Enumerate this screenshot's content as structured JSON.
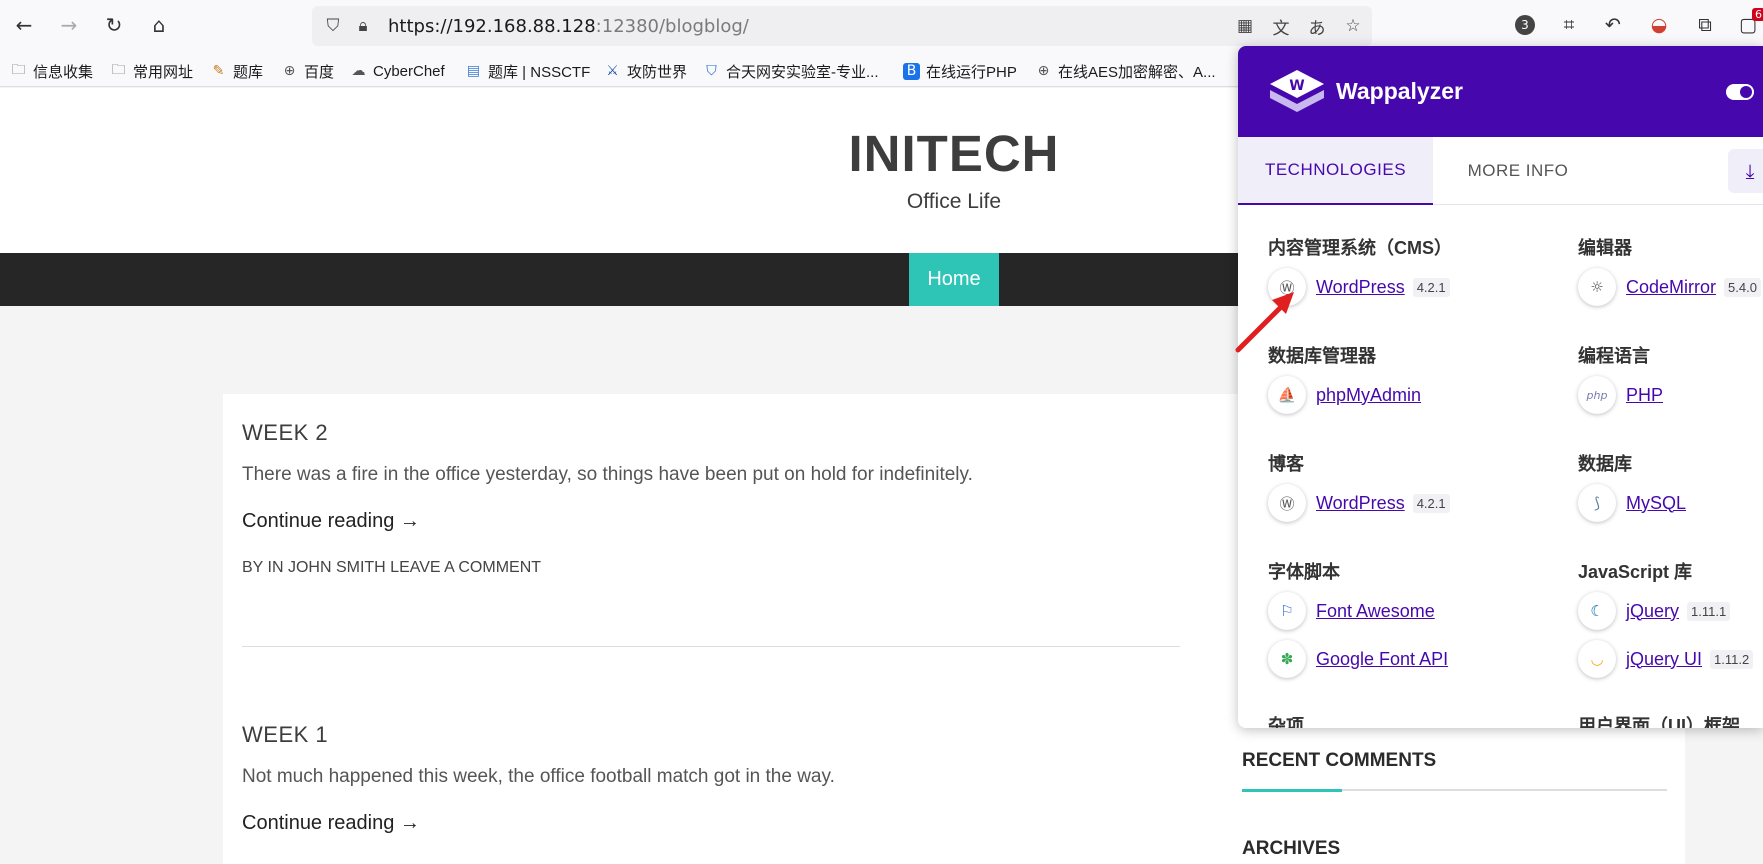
{
  "browser": {
    "url_host": "https://192.168.88.128",
    "url_path": ":12380/blogblog/",
    "badge_count": "3",
    "notif_count": "6"
  },
  "bookmarks": [
    {
      "label": "信息收集",
      "icon": "folder-icon"
    },
    {
      "label": "常用网址",
      "icon": "folder-icon"
    },
    {
      "label": "题库",
      "icon": "site-icon"
    },
    {
      "label": "百度",
      "icon": "globe-icon"
    },
    {
      "label": "CyberChef",
      "icon": "chef-icon"
    },
    {
      "label": "题库 | NSSCTF",
      "icon": "site-icon"
    },
    {
      "label": "攻防世界",
      "icon": "site-icon"
    },
    {
      "label": "合天网安实验室-专业...",
      "icon": "shield-icon"
    },
    {
      "label": "在线运行PHP",
      "icon": "site-icon"
    },
    {
      "label": "在线AES加密解密、A...",
      "icon": "globe-icon"
    }
  ],
  "site": {
    "title": "INITECH",
    "tagline": "Office Life",
    "nav_home": "Home"
  },
  "posts": [
    {
      "title": "WEEK 2",
      "excerpt": "There was a fire in the office yesterday, so things have been put on hold for indefinitely.",
      "more": "Continue reading →",
      "meta": "BY IN JOHN SMITH LEAVE A COMMENT"
    },
    {
      "title": "WEEK 1",
      "excerpt": "Not much happened this week, the office football match got in the way.",
      "more": "Continue reading →"
    }
  ],
  "sidebar": {
    "recent_comments": "RECENT COMMENTS",
    "archives": "ARCHIVES"
  },
  "wappalyzer": {
    "title": "Wappalyzer",
    "tab_technologies": "TECHNOLOGIES",
    "tab_more_info": "MORE INFO",
    "categories": {
      "cms": "内容管理系统（CMS）",
      "editor": "编辑器",
      "dbmanager": "数据库管理器",
      "lang": "编程语言",
      "blog": "博客",
      "db": "数据库",
      "font": "字体脚本",
      "jslib": "JavaScript 库",
      "misc": "杂项",
      "ui": "用户界面（UI）框架"
    },
    "techs": {
      "wordpress": "WordPress",
      "wordpress_ver": "4.2.1",
      "codemirror": "CodeMirror",
      "codemirror_ver": "5.4.0",
      "phpmyadmin": "phpMyAdmin",
      "php": "PHP",
      "wordpress_blog": "WordPress",
      "wordpress_blog_ver": "4.2.1",
      "mysql": "MySQL",
      "fontawesome": "Font Awesome",
      "jquery": "jQuery",
      "jquery_ver": "1.11.1",
      "googlefont": "Google Font API",
      "jqueryui": "jQuery UI",
      "jqueryui_ver": "1.11.2"
    }
  },
  "colors": {
    "wappalyzer_purple": "#4608ad",
    "accent_teal": "#2ec5b6",
    "nav_dark": "#262626",
    "annotation_red": "#e02020"
  }
}
